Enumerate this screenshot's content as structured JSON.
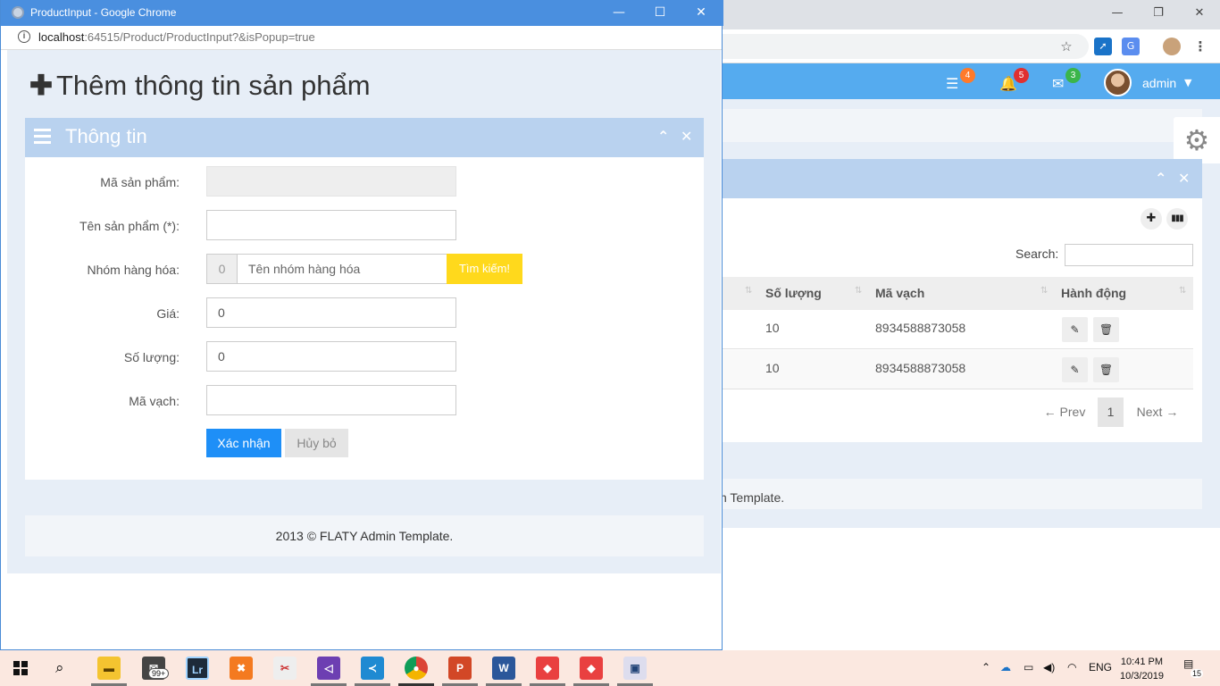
{
  "background": {
    "navbar": {
      "badges": [
        "4",
        "5",
        "3"
      ],
      "badge_colors": [
        "#ff7a2a",
        "#e03030",
        "#3bb54a"
      ],
      "user": "admin"
    },
    "toolbar": {
      "add_icon": "plus-icon",
      "barcode_icon": "barcode-icon"
    },
    "search": {
      "label": "Search:",
      "placeholder": ""
    },
    "table": {
      "columns": [
        "Số lượng",
        "Mã vạch",
        "Hành động"
      ],
      "rows": [
        {
          "qty": "10",
          "barcode": "8934588873058"
        },
        {
          "qty": "10",
          "barcode": "8934588873058"
        }
      ]
    },
    "pager": {
      "prev": "← Prev",
      "page": "1",
      "next": "Next →"
    },
    "footer": "n Template."
  },
  "popup": {
    "window_title": "ProductInput - Google Chrome",
    "url_host": "localhost",
    "url_path": ":64515/Product/ProductInput?&isPopup=true",
    "page_title": "Thêm thông tin sản phẩm",
    "box_title": "Thông tin",
    "form": {
      "code_label": "Mã sản phẩm:",
      "code_value": "",
      "name_label": "Tên sản phẩm (*):",
      "name_value": "",
      "group_label": "Nhóm hàng hóa:",
      "group_id": "0",
      "group_name_placeholder": "Tên nhóm hàng hóa",
      "group_search_button": "Tìm kiếm!",
      "price_label": "Giá:",
      "price_value": "0",
      "qty_label": "Số lượng:",
      "qty_value": "0",
      "barcode_label": "Mã vạch:",
      "barcode_value": "",
      "submit_label": "Xác nhận",
      "cancel_label": "Hủy bỏ"
    },
    "footer": "2013 © FLATY Admin Template."
  },
  "taskbar": {
    "mail_badge": "99+",
    "language": "ENG",
    "time": "10:41 PM",
    "date": "10/3/2019",
    "notifications": "15"
  },
  "colors": {
    "navbar": "#55abef",
    "box_header": "#b9d2ef",
    "primary_button": "#1e8ff7",
    "search_button": "#ffd91c"
  }
}
